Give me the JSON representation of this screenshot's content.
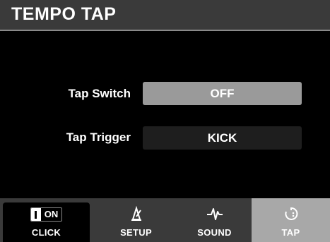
{
  "header": {
    "title": "TEMPO TAP"
  },
  "settings": [
    {
      "label": "Tap Switch",
      "value": "OFF"
    },
    {
      "label": "Tap Trigger",
      "value": "KICK"
    }
  ],
  "tabs": [
    {
      "label": "CLICK",
      "icon": "on-toggle-icon",
      "badge": "ON"
    },
    {
      "label": "SETUP",
      "icon": "metronome-icon"
    },
    {
      "label": "SOUND",
      "icon": "waveform-icon"
    },
    {
      "label": "TAP",
      "icon": "tap-timer-icon",
      "selected": true
    }
  ],
  "colors": {
    "header_bg": "#3a3a3a",
    "selected_field": "#9a9a9a",
    "field_bg": "#1e1e1e",
    "selected_tab": "#a8a8a8"
  }
}
